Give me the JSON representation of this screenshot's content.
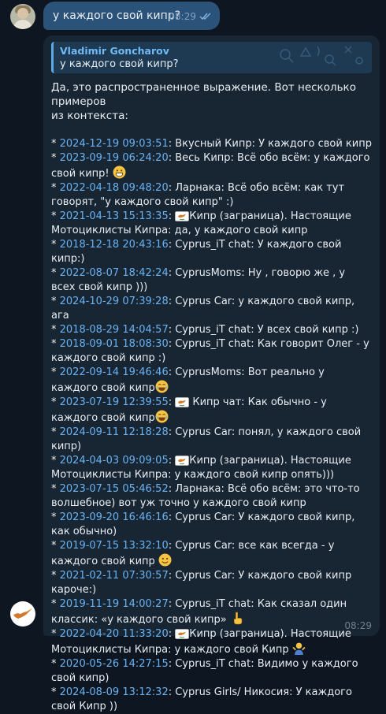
{
  "outgoing": {
    "text": "у каждого свой кипр?",
    "time": "08:29"
  },
  "reply": {
    "author": "Vladimir Goncharov",
    "quote": "у каждого свой кипр?",
    "intro": "Да, это распространенное выражение. Вот несколько примеров\nиз контекста:",
    "entries": [
      {
        "ts": "2024-12-19 09:03:51",
        "text": ": Вкусный Кипр: У каждого свой кипр"
      },
      {
        "ts": "2023-09-19 06:24:20",
        "text": ": Весь Кипр: Всё обо всём: у каждого свой кипр! ",
        "emoji": "grin"
      },
      {
        "ts": "2022-04-18 09:48:20",
        "text": ": Ларнака: Всё обо всём: как тут говорят, \"у каждого свой кипр\" :)"
      },
      {
        "ts": "2021-04-13 15:13:35",
        "text": ": ",
        "pre_emoji": "flag",
        "text2": "Кипр (заграница). Настоящие Мотоциклисты Кипра: да, у каждого свой кипр"
      },
      {
        "ts": "2018-12-18 20:43:16",
        "text": ": Cyprus_iT chat: У каждого свой кипр:)"
      },
      {
        "ts": "2022-08-07 18:42:24",
        "text": ": CyprusMoms: Ну , говорю же , у всех свой кипр )))"
      },
      {
        "ts": "2024-10-29 07:39:28",
        "text": ": Cyprus Car: у каждого свой кипр, ага"
      },
      {
        "ts": "2018-08-29 14:04:57",
        "text": ": Cyprus_iT chat: У всех свой кипр :)"
      },
      {
        "ts": "2018-09-01 18:08:30",
        "text": ": Cyprus_iT chat: Как говорит Олег - у каждого свой кипр :)"
      },
      {
        "ts": "2022-09-14 19:46:46",
        "text": ": CyprusMoms: Вот реально у каждого свой кипр",
        "emoji": "joy"
      },
      {
        "ts": "2023-07-19 12:39:55",
        "text": ": ",
        "pre_emoji": "flag",
        "text2": " Кипр чат: Как обычно - у каждого свой кипр",
        "emoji": "joy"
      },
      {
        "ts": "2024-09-11 12:18:28",
        "text": ": Cyprus Car: понял, у каждого свой кипр)"
      },
      {
        "ts": "2024-04-03 09:09:05",
        "text": ": ",
        "pre_emoji": "flag",
        "text2": "Кипр (заграница). Настоящие Мотоциклисты Кипра: у каждого свой кипр опять)))"
      },
      {
        "ts": "2023-07-15 05:46:52",
        "text": ": Ларнака: Всё обо всём: это что-то волшебное) вот уж точно у каждого свой кипр"
      },
      {
        "ts": "2023-09-20 16:46:16",
        "text": ": Cyprus Car: У каждого свой кипр, как обычно)"
      },
      {
        "ts": "2019-07-15 13:32:10",
        "text": ": Cyprus Car: все как всегда - у каждого свой кипр ",
        "emoji": "smile"
      },
      {
        "ts": "2021-02-11 07:30:57",
        "text": ": Cyprus Car: У каждого свой кипр кароче:)"
      },
      {
        "ts": "2019-11-19 14:00:27",
        "text": ": Cyprus_iT chat: Как сказал один классик: «у каждого свой кипр» ",
        "emoji": "point"
      },
      {
        "ts": "2022-04-20 11:33:20",
        "text": ": ",
        "pre_emoji": "flag",
        "text2": "Кипр (заграница). Настоящие Мотоциклисты Кипра: у каждого свой Кипр ",
        "emoji": "shrug"
      },
      {
        "ts": "2020-05-26 14:27:15",
        "text": ": Cyprus_iT chat: Видимо у каждого свой кипр)"
      },
      {
        "ts": "2024-08-09 13:12:32",
        "text": ": Cyprus Girls/ Никосия: У каждого свой Кипр ))"
      }
    ],
    "time": "08:29"
  },
  "icons": {
    "read_status": "double-check-icon",
    "user_avatar": "user-avatar",
    "bot_avatar": "cyprus-map-avatar"
  },
  "colors": {
    "background": "#0e1621",
    "outgoing_bubble": "#2b5278",
    "incoming_bubble": "#182533",
    "link": "#6ab3f3",
    "author": "#71baf5"
  }
}
